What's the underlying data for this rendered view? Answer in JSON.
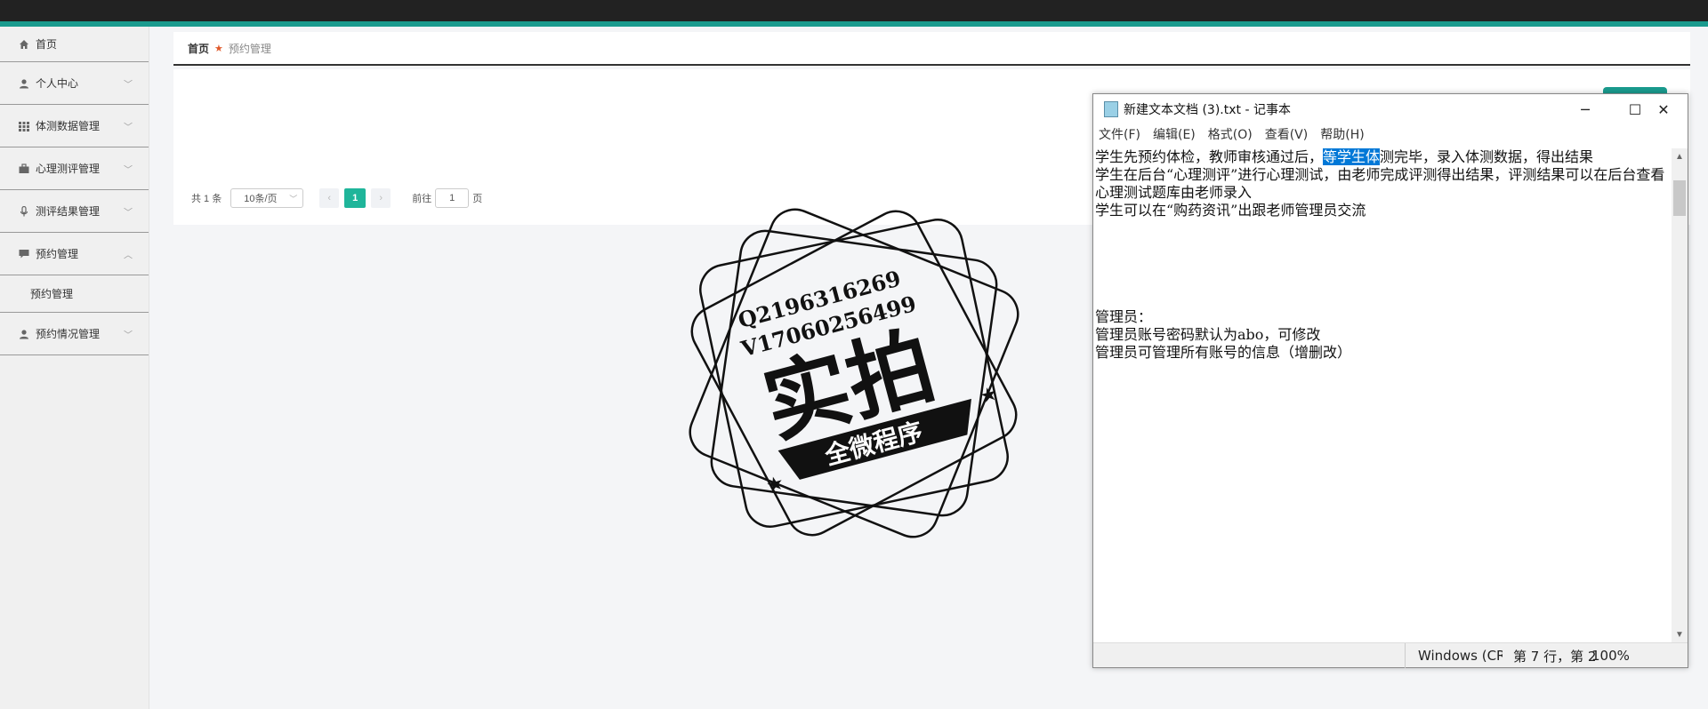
{
  "sidebar": {
    "items": [
      {
        "label": "首页"
      },
      {
        "label": "个人中心"
      },
      {
        "label": "体测数据管理"
      },
      {
        "label": "心理测评管理"
      },
      {
        "label": "测评结果管理"
      },
      {
        "label": "预约管理"
      },
      {
        "label": "预约管理"
      },
      {
        "label": "预约情况管理"
      }
    ]
  },
  "breadcrumb": {
    "home": "首页",
    "current": "预约管理"
  },
  "pager": {
    "total": "共 1 条",
    "page_size": "10条/页",
    "current_page": "1",
    "goto_label": "前往",
    "goto_value": "1",
    "page_label": "页"
  },
  "stamp": {
    "line1": "Q2196316269",
    "line2": "V17060256499",
    "big": "实拍",
    "banner": "全微程序"
  },
  "notepad": {
    "title": "新建文本文档 (3).txt - 记事本",
    "menu": [
      "文件(F)",
      "编辑(E)",
      "格式(O)",
      "查看(V)",
      "帮助(H)"
    ],
    "line1_pre": "学生先预约体检，教师审核通过后，",
    "line1_sel": "等学生体",
    "line1_post": "测完毕，录入体测数据，得出结果",
    "lines": [
      "学生在后台“心理测评”进行心理测试，由老师完成评测得出结果，评测结果可以在后台查看",
      "心理测试题库由老师录入",
      "学生可以在“购药资讯”出跟老师管理员交流",
      "",
      "",
      "",
      "",
      "",
      "管理员：",
      "管理员账号密码默认为abo，可修改",
      "管理员可管理所有账号的信息（增删改）"
    ],
    "status": {
      "encoding": "Windows (CR",
      "position": "第 7 行，第 2",
      "zoom": "100%"
    }
  }
}
